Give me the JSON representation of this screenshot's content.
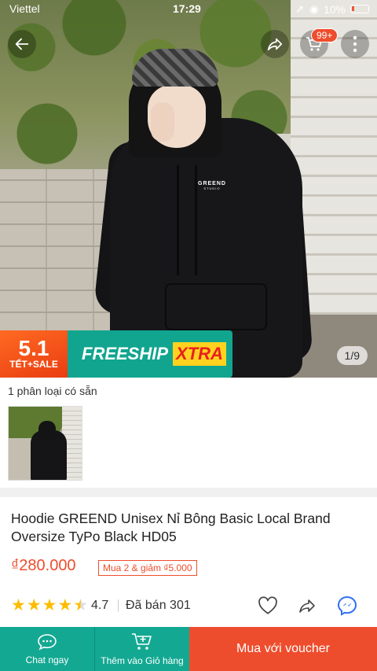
{
  "status_bar": {
    "carrier": "Viettel",
    "time": "17:29",
    "battery": "10%"
  },
  "top_nav": {
    "cart_badge": "99+"
  },
  "banner": {
    "tet_big": "5.1",
    "tet_small": "TẾT+SALE",
    "freeship": "FREESHIP",
    "xtra": "XTRA"
  },
  "gallery": {
    "counter": "1/9",
    "product_logo": "GREEND",
    "product_logo_sub": "STUDIO"
  },
  "variants": {
    "label": "1 phân loại có sẵn"
  },
  "product": {
    "title": "Hoodie GREEND Unisex Nỉ Bông Basic Local Brand Oversize TyPo Black HD05",
    "price": "₫280.000",
    "promo": "Mua 2 & giảm ₫5.000",
    "rating": "4.7",
    "stars_value": 4.5,
    "sold": "Đã bán 301"
  },
  "bottom_bar": {
    "chat_label": "Chat ngay",
    "add_cart_label": "Thêm vào Giỏ hàng",
    "buy_label": "Mua với voucher"
  },
  "colors": {
    "accent": "#ee4d2d",
    "teal": "#13a892",
    "star": "#fcbd01"
  },
  "icons": [
    "back-arrow-icon",
    "share-icon",
    "cart-icon",
    "more-icon",
    "heart-icon",
    "messenger-icon",
    "chat-icon",
    "add-cart-icon",
    "star-icon"
  ]
}
